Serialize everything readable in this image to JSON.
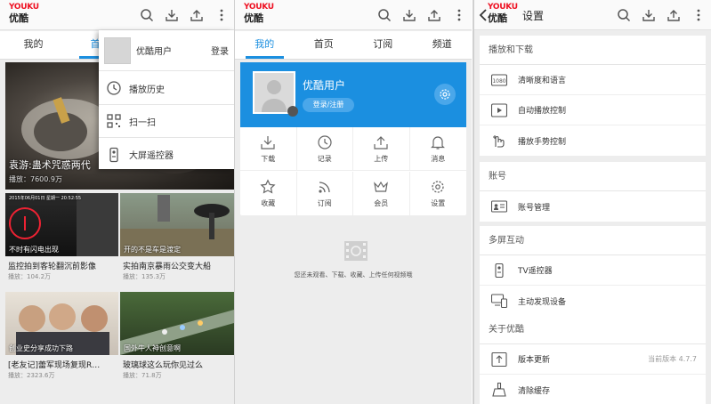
{
  "brand": {
    "logo_top": "YOUKU",
    "logo_bottom": "优酷"
  },
  "colors": {
    "accent": "#1b8fe0",
    "brand_red": "#e12"
  },
  "panel1": {
    "tabs": [
      "我的",
      "首页"
    ],
    "drawer": {
      "user_name": "优酷用户",
      "login_label": "登录",
      "items": [
        "播放历史",
        "扫一扫",
        "大屏遥控器"
      ]
    },
    "hero": {
      "caption": "袁游:蛊术咒惑两代",
      "plays": "播放：7600.9万"
    },
    "videos": [
      {
        "title": "监控拍到客轮翻沉前影像",
        "plays": "播放：104.2万",
        "caption": "不时有闪电出现",
        "timestamp": "2015年06月01日 星期一 20:52:55"
      },
      {
        "title": "实拍南京暴雨公交变大船",
        "plays": "播放：135.3万",
        "caption": "开的不是车是渡定"
      },
      {
        "title": "[老友记]蕾军现场复现R…",
        "plays": "播放：2323.6万",
        "caption": "创业史分享成功下路"
      },
      {
        "title": "玻璃球这么玩你见过么",
        "plays": "播放：71.8万",
        "caption": "国外牛人神创意啊"
      }
    ]
  },
  "panel2": {
    "tabs": [
      "我的",
      "首页",
      "订阅",
      "频道"
    ],
    "profile": {
      "name": "优酷用户",
      "login_button": "登录/注册"
    },
    "grid": [
      "下载",
      "记录",
      "上传",
      "消息",
      "收藏",
      "订阅",
      "会员",
      "设置"
    ],
    "empty_message": "您还未观看、下载、收藏、上传任何视频哦"
  },
  "panel3": {
    "title": "设置",
    "sections": [
      {
        "heading": "播放和下载",
        "items": [
          {
            "label": "清晰度和语言",
            "icon": "1080-icon"
          },
          {
            "label": "自动播放控制",
            "icon": "play-icon"
          },
          {
            "label": "播放手势控制",
            "icon": "gesture-icon"
          }
        ]
      },
      {
        "heading": "账号",
        "items": [
          {
            "label": "账号管理",
            "icon": "account-card-icon"
          }
        ]
      },
      {
        "heading": "多屏互动",
        "items": [
          {
            "label": "TV遥控器",
            "icon": "remote-icon"
          },
          {
            "label": "主动发现设备",
            "icon": "devices-icon"
          }
        ]
      },
      {
        "heading": "关于优酷",
        "items": [
          {
            "label": "版本更新",
            "icon": "upload-icon",
            "value": "当前版本 4.7.7"
          },
          {
            "label": "清除缓存",
            "icon": "broom-icon"
          }
        ]
      }
    ]
  },
  "icons": {
    "icon_1080": "1080"
  }
}
